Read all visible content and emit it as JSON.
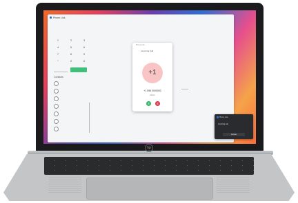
{
  "app": {
    "title": "Phone Link"
  },
  "dialpad": {
    "keys": [
      "1",
      "2",
      "3",
      "4",
      "5",
      "6",
      "7",
      "8",
      "9",
      "*",
      "0",
      "#"
    ]
  },
  "contacts": {
    "section_label": "Contacts",
    "items": [
      "",
      "",
      "",
      "",
      "",
      "",
      ""
    ]
  },
  "call": {
    "status": "Incoming Call",
    "avatar_text": "+1",
    "number": "+1 555 0000000",
    "sub": "Mobile",
    "answer_icon": "phone-icon",
    "decline_icon": "phone-hangup-icon"
  },
  "toast": {
    "app": "Phone Link",
    "line1": "Incoming call",
    "line2": "",
    "action": "Answer"
  },
  "colors": {
    "answer": "#2fb36b",
    "decline": "#d8354b",
    "avatar": "#f9c4c4",
    "dial_call": "#3fbf7a"
  }
}
